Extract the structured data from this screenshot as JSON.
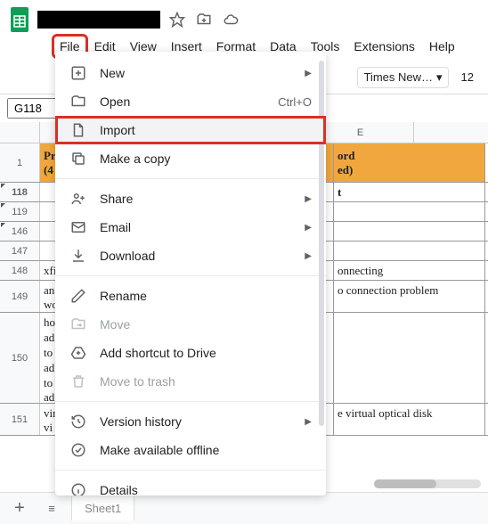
{
  "doc": {
    "title_hidden": true
  },
  "title_icons": [
    "star-icon",
    "move-icon",
    "cloud-icon"
  ],
  "menubar": [
    "File",
    "Edit",
    "View",
    "Insert",
    "Format",
    "Data",
    "Tools",
    "Extensions",
    "Help"
  ],
  "active_menu_index": 0,
  "toolbar": {
    "font_name": "Times New…",
    "font_size": "12",
    "name_box": "G118"
  },
  "columns": {
    "visible": "E"
  },
  "header_row": {
    "num": "1",
    "b_label_line1": "Pr",
    "b_label_line2": "(4",
    "e_label_line1": "ord",
    "e_label_line2": "ed)"
  },
  "rows": [
    {
      "num": "118",
      "e": "t",
      "bold": true,
      "tri": true
    },
    {
      "num": "119",
      "e": "",
      "tri": true
    },
    {
      "num": "146",
      "e": "",
      "tri": true
    },
    {
      "num": "147",
      "e": ""
    },
    {
      "num": "148",
      "b": "xfi",
      "e": "onnecting"
    },
    {
      "num": "149",
      "b_l1": "an",
      "b_l2": "wo",
      "e": "o connection problem"
    },
    {
      "num": "150",
      "b_lines": [
        "ho",
        "ad",
        "to",
        "ad",
        "to",
        "ad"
      ],
      "e": ""
    },
    {
      "num": "151",
      "b_l1": "vir",
      "b_l2": "vi",
      "e": "e virtual optical disk"
    }
  ],
  "menu": {
    "items": [
      {
        "icon": "plus-box-icon",
        "label": "New",
        "arrow": true
      },
      {
        "icon": "folder-icon",
        "label": "Open",
        "shortcut": "Ctrl+O"
      },
      {
        "icon": "file-icon",
        "label": "Import",
        "highlighted": true
      },
      {
        "icon": "copy-icon",
        "label": "Make a copy"
      },
      {
        "divider": true
      },
      {
        "icon": "person-plus-icon",
        "label": "Share",
        "arrow": true
      },
      {
        "icon": "mail-icon",
        "label": "Email",
        "arrow": true
      },
      {
        "icon": "download-icon",
        "label": "Download",
        "arrow": true
      },
      {
        "divider": true
      },
      {
        "icon": "pencil-icon",
        "label": "Rename"
      },
      {
        "icon": "folder-move-icon",
        "label": "Move",
        "disabled": true
      },
      {
        "icon": "drive-plus-icon",
        "label": "Add shortcut to Drive"
      },
      {
        "icon": "trash-icon",
        "label": "Move to trash",
        "disabled": true
      },
      {
        "divider": true
      },
      {
        "icon": "history-icon",
        "label": "Version history",
        "arrow": true
      },
      {
        "icon": "offline-icon",
        "label": "Make available offline"
      },
      {
        "divider": true
      },
      {
        "icon": "info-icon",
        "label": "Details"
      }
    ]
  },
  "sheet_tab": "Sheet1"
}
